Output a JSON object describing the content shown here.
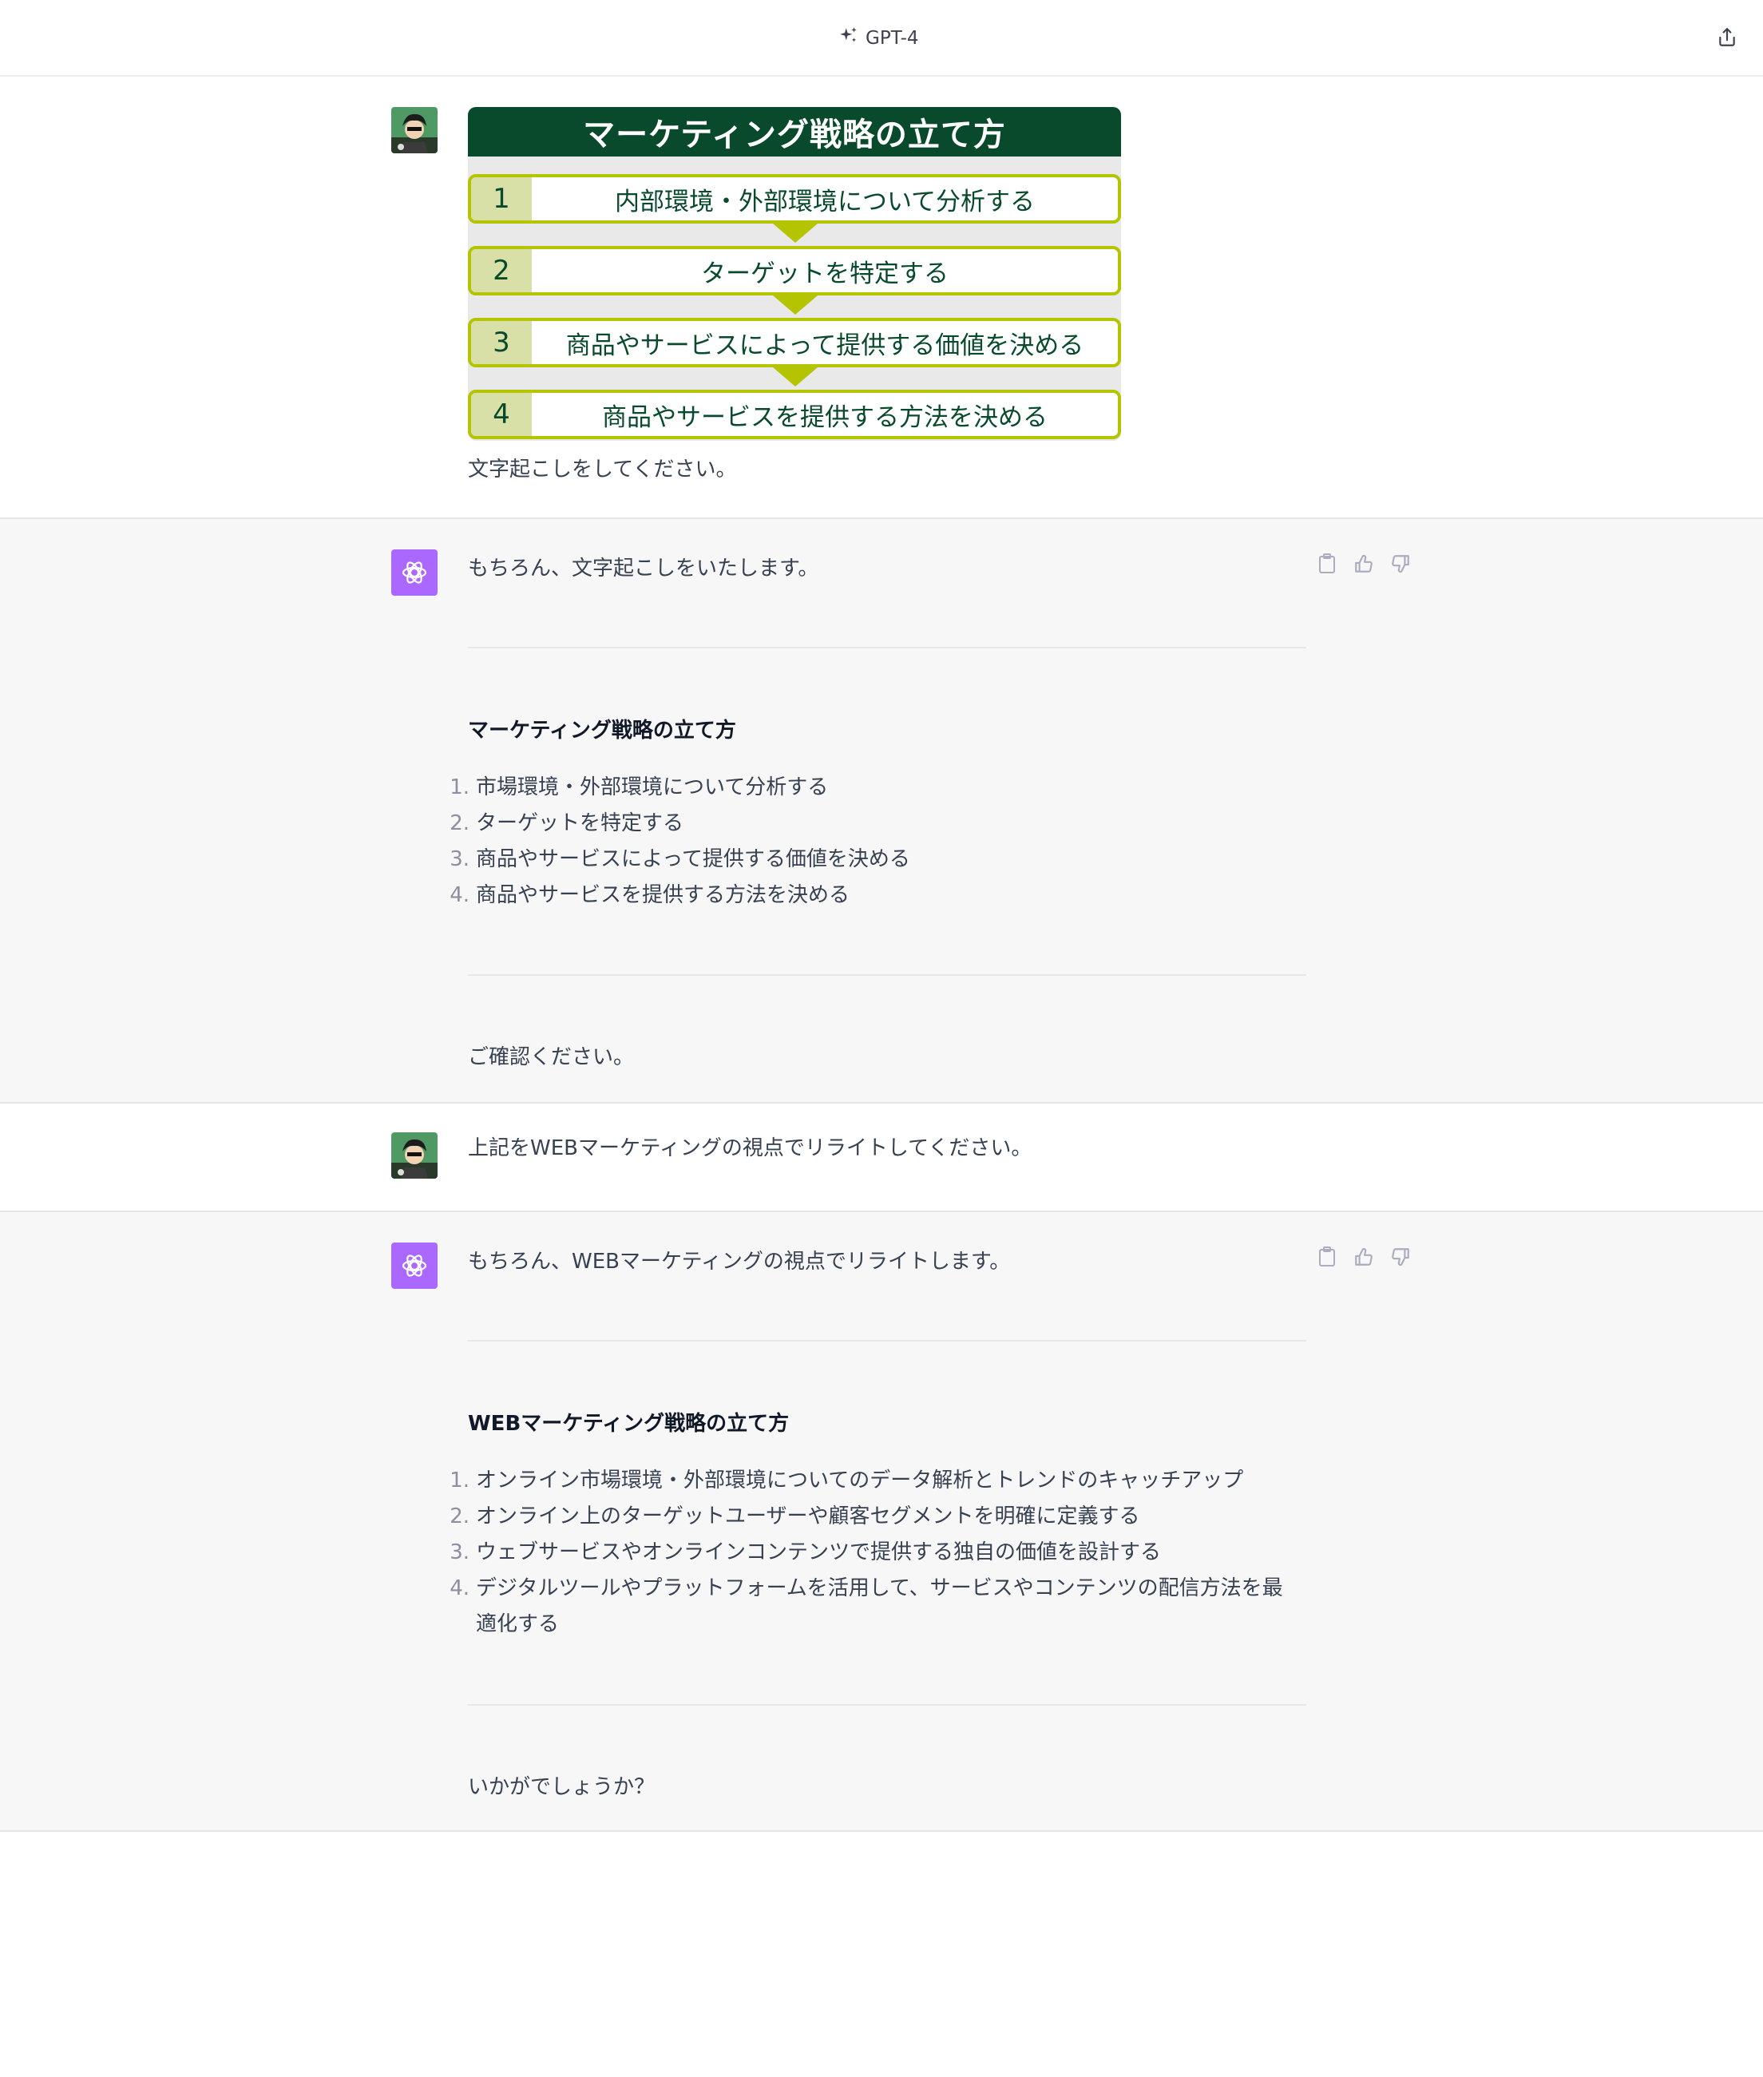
{
  "header": {
    "model_label": "GPT-4"
  },
  "turns": {
    "u1": {
      "image": {
        "title": "マーケティング戦略の立て方",
        "steps": [
          {
            "num": "1",
            "text": "内部環境・外部環境について分析する"
          },
          {
            "num": "2",
            "text": "ターゲットを特定する"
          },
          {
            "num": "3",
            "text": "商品やサービスによって提供する価値を決める"
          },
          {
            "num": "4",
            "text": "商品やサービスを提供する方法を決める"
          }
        ]
      },
      "text": "文字起こしをしてください。"
    },
    "a1": {
      "intro": "もちろん、文字起こしをいたします。",
      "heading": "マーケティング戦略の立て方",
      "items": [
        {
          "num": "1.",
          "text": "市場環境・外部環境について分析する"
        },
        {
          "num": "2.",
          "text": "ターゲットを特定する"
        },
        {
          "num": "3.",
          "text": "商品やサービスによって提供する価値を決める"
        },
        {
          "num": "4.",
          "text": "商品やサービスを提供する方法を決める"
        }
      ],
      "closing": "ご確認ください。"
    },
    "u2": {
      "text": "上記をWEBマーケティングの視点でリライトしてください。"
    },
    "a2": {
      "intro": "もちろん、WEBマーケティングの視点でリライトします。",
      "heading": "WEBマーケティング戦略の立て方",
      "items": [
        {
          "num": "1.",
          "text": "オンライン市場環境・外部環境についてのデータ解析とトレンドのキャッチアップ"
        },
        {
          "num": "2.",
          "text": "オンライン上のターゲットユーザーや顧客セグメントを明確に定義する"
        },
        {
          "num": "3.",
          "text": "ウェブサービスやオンラインコンテンツで提供する独自の価値を設計する"
        },
        {
          "num": "4.",
          "text": "デジタルツールやプラットフォームを活用して、サービスやコンテンツの配信方法を最適化する"
        }
      ],
      "closing": "いかがでしょうか？"
    }
  },
  "icons": {
    "model": "sparkle-icon",
    "share": "share-icon",
    "copy": "clipboard-icon",
    "like": "thumbs-up-icon",
    "dislike": "thumbs-down-icon",
    "bot": "openai-logo-icon"
  },
  "colors": {
    "bot_avatar": "#ab68ff",
    "assistant_bg": "#f7f7f8",
    "infographic_title_bg": "#0a4a2c",
    "infographic_border": "#b5c400"
  }
}
